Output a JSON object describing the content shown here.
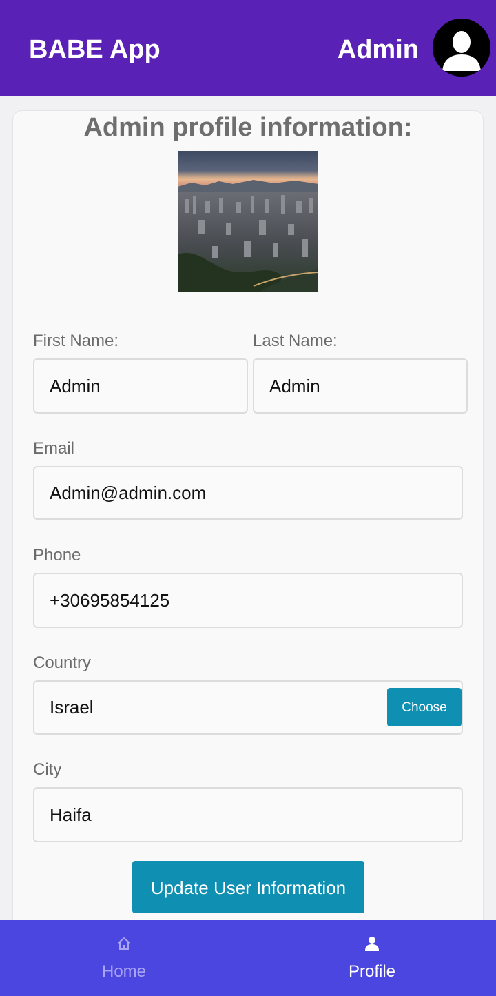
{
  "header": {
    "app_title": "BABE App",
    "user_name": "Admin",
    "avatar_icon": "user-avatar-icon"
  },
  "profile": {
    "title": "Admin profile information:",
    "photo": "city-skyline-photo",
    "first_name_label": "First Name:",
    "first_name_value": "Admin",
    "last_name_label": "Last Name:",
    "last_name_value": "Admin",
    "email_label": "Email",
    "email_value": "Admin@admin.com",
    "phone_label": "Phone",
    "phone_value": "+30695854125",
    "country_label": "Country",
    "country_value": "Israel",
    "choose_label": "Choose",
    "city_label": "City",
    "city_value": "Haifa",
    "update_label": "Update User Information"
  },
  "bottom_nav": {
    "items": [
      {
        "label": "Home",
        "icon": "home-icon",
        "active": false
      },
      {
        "label": "Profile",
        "icon": "person-icon",
        "active": true
      }
    ]
  },
  "colors": {
    "app_bar": "#5a21b6",
    "bottom_nav": "#4c46e0",
    "button": "#0f8fb2",
    "nav_inactive": "#a9a4f3"
  }
}
